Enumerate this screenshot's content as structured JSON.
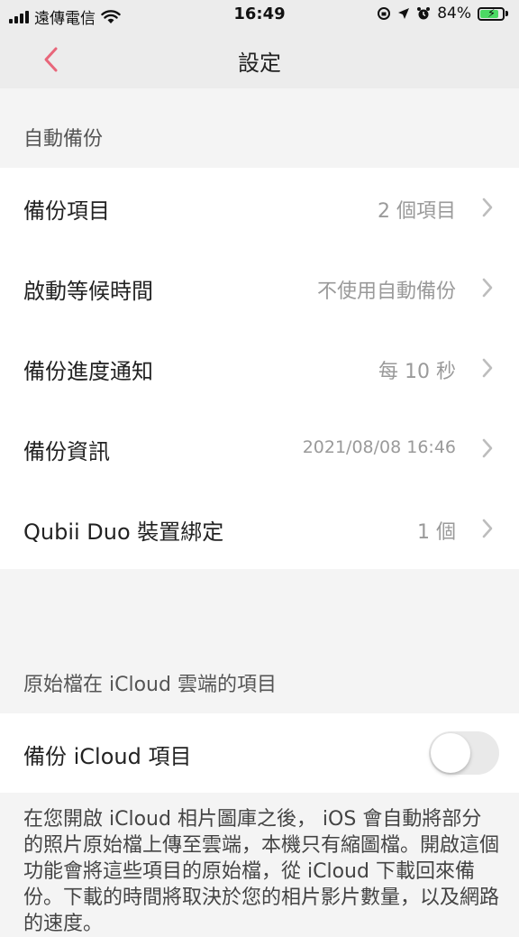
{
  "status_bar": {
    "carrier": "遠傳電信",
    "time": "16:49",
    "battery": "84%",
    "battery_level": 0.84,
    "icons": [
      "signal-icon",
      "wifi-icon",
      "rotation-lock-icon",
      "location-icon",
      "alarm-icon",
      "battery-icon"
    ]
  },
  "nav": {
    "title": "設定",
    "back_icon": "chevron-left-icon",
    "accent_color": "#e8667a"
  },
  "auto_backup": {
    "header": "自動備份",
    "rows": [
      {
        "label": "備份項目",
        "value": "2 個項目"
      },
      {
        "label": "啟動等候時間",
        "value": "不使用自動備份"
      },
      {
        "label": "備份進度通知",
        "value": "每 10 秒"
      },
      {
        "label": "備份資訊",
        "value": "2021/08/08 16:46"
      },
      {
        "label": "Qubii Duo 裝置綁定",
        "value": "1 個"
      }
    ]
  },
  "icloud": {
    "header": "原始檔在 iCloud 雲端的項目",
    "toggle_label": "備份 iCloud 項目",
    "toggle_on": false,
    "description": "在您開啟 iCloud 相片圖庫之後， iOS 會自動將部分的照片原始檔上傳至雲端，本機只有縮圖檔。開啟這個功能會將這些項目的原始檔，從 iCloud 下載回來備份。下載的時間將取決於您的相片影片數量，以及網路的速度。"
  }
}
